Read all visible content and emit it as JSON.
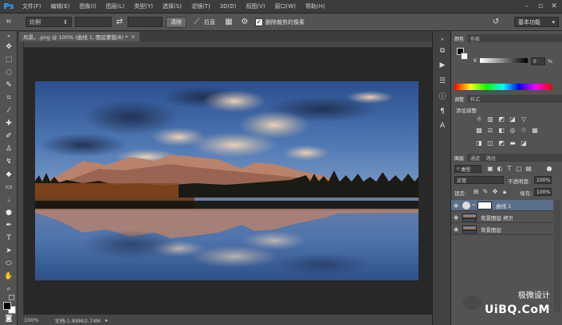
{
  "app": {
    "logo": "Ps"
  },
  "menu": [
    "文件(F)",
    "编辑(E)",
    "图像(I)",
    "图层(L)",
    "类型(Y)",
    "选择(S)",
    "滤镜(T)",
    "3D(D)",
    "视图(V)",
    "窗口(W)",
    "帮助(H)"
  ],
  "window_controls": [
    "minimize-icon",
    "restore-icon",
    "close-icon"
  ],
  "options": {
    "ratio_select": "比例",
    "straighten_btn": "清除",
    "straighten_label": "拉直",
    "delete_checkbox_label": "删除裁剪的像素",
    "workspace": "基本功能"
  },
  "document": {
    "tab_title": "风景。.png @ 100% (曲线 1, 图层蒙版/8) *",
    "zoom": "100%",
    "doc_info": "文档:1.89M/2.74M"
  },
  "panels": {
    "color_tabs": [
      "颜色",
      "色板"
    ],
    "color_slider_label": "K",
    "color_value": "0",
    "color_unit": "%",
    "adjust_tabs": [
      "调整",
      "样式"
    ],
    "adjust_title": "添加调整",
    "layers_tabs": [
      "图层",
      "通道",
      "路径"
    ],
    "kind_filter": "类型",
    "blend_mode": "正常",
    "opacity_label": "不透明度:",
    "opacity_value": "100%",
    "lock_label": "锁定:",
    "fill_label": "填充:",
    "fill_value": "100%",
    "layers": [
      {
        "name": "曲线 1"
      },
      {
        "name": "背景图层 拷贝"
      },
      {
        "name": "背景图层"
      }
    ]
  },
  "watermark": {
    "text1": "极微设计",
    "text2": "UiBQ.CoM"
  },
  "colors": {
    "accent": "#31a8ff",
    "selected_layer": "#5b6e8a"
  }
}
